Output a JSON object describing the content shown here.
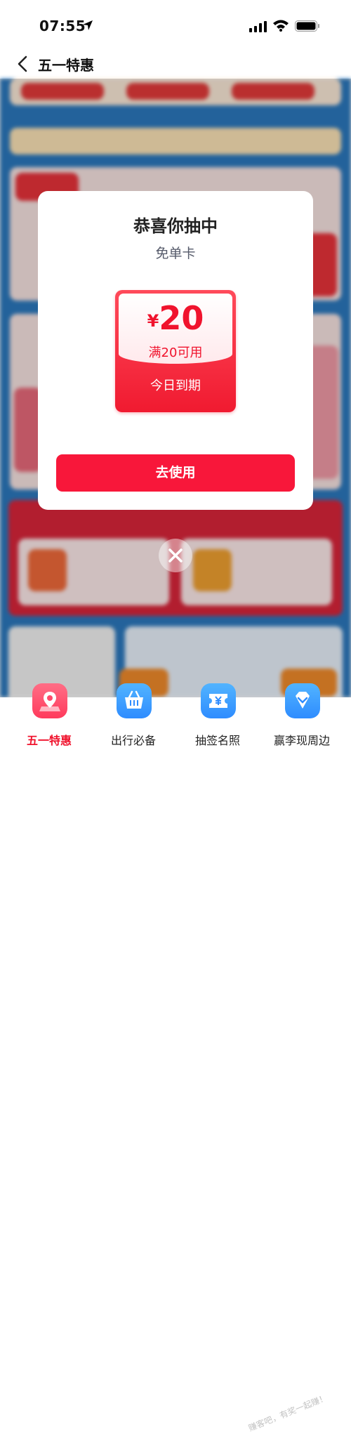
{
  "status_bar": {
    "time": "07:55"
  },
  "nav": {
    "title": "五一特惠"
  },
  "modal": {
    "title": "恭喜你抽中",
    "subtitle": "免单卡",
    "coupon": {
      "currency": "¥",
      "amount": "20",
      "condition": "满20可用",
      "expiry": "今日到期"
    },
    "button_label": "去使用"
  },
  "tabs": [
    {
      "label": "五一特惠",
      "icon": "map-pin-icon",
      "active": true,
      "color": "#ff4a6a"
    },
    {
      "label": "出行必备",
      "icon": "basket-icon",
      "active": false,
      "color": "#2e9bff"
    },
    {
      "label": "抽签名照",
      "icon": "ticket-icon",
      "active": false,
      "color": "#2e9bff"
    },
    {
      "label": "赢李现周边",
      "icon": "diamond-icon",
      "active": false,
      "color": "#2e9bff"
    }
  ],
  "watermark": "赚客吧，有奖一起赚！",
  "colors": {
    "accent": "#f8173a",
    "background_blue": "#2b78bd"
  }
}
